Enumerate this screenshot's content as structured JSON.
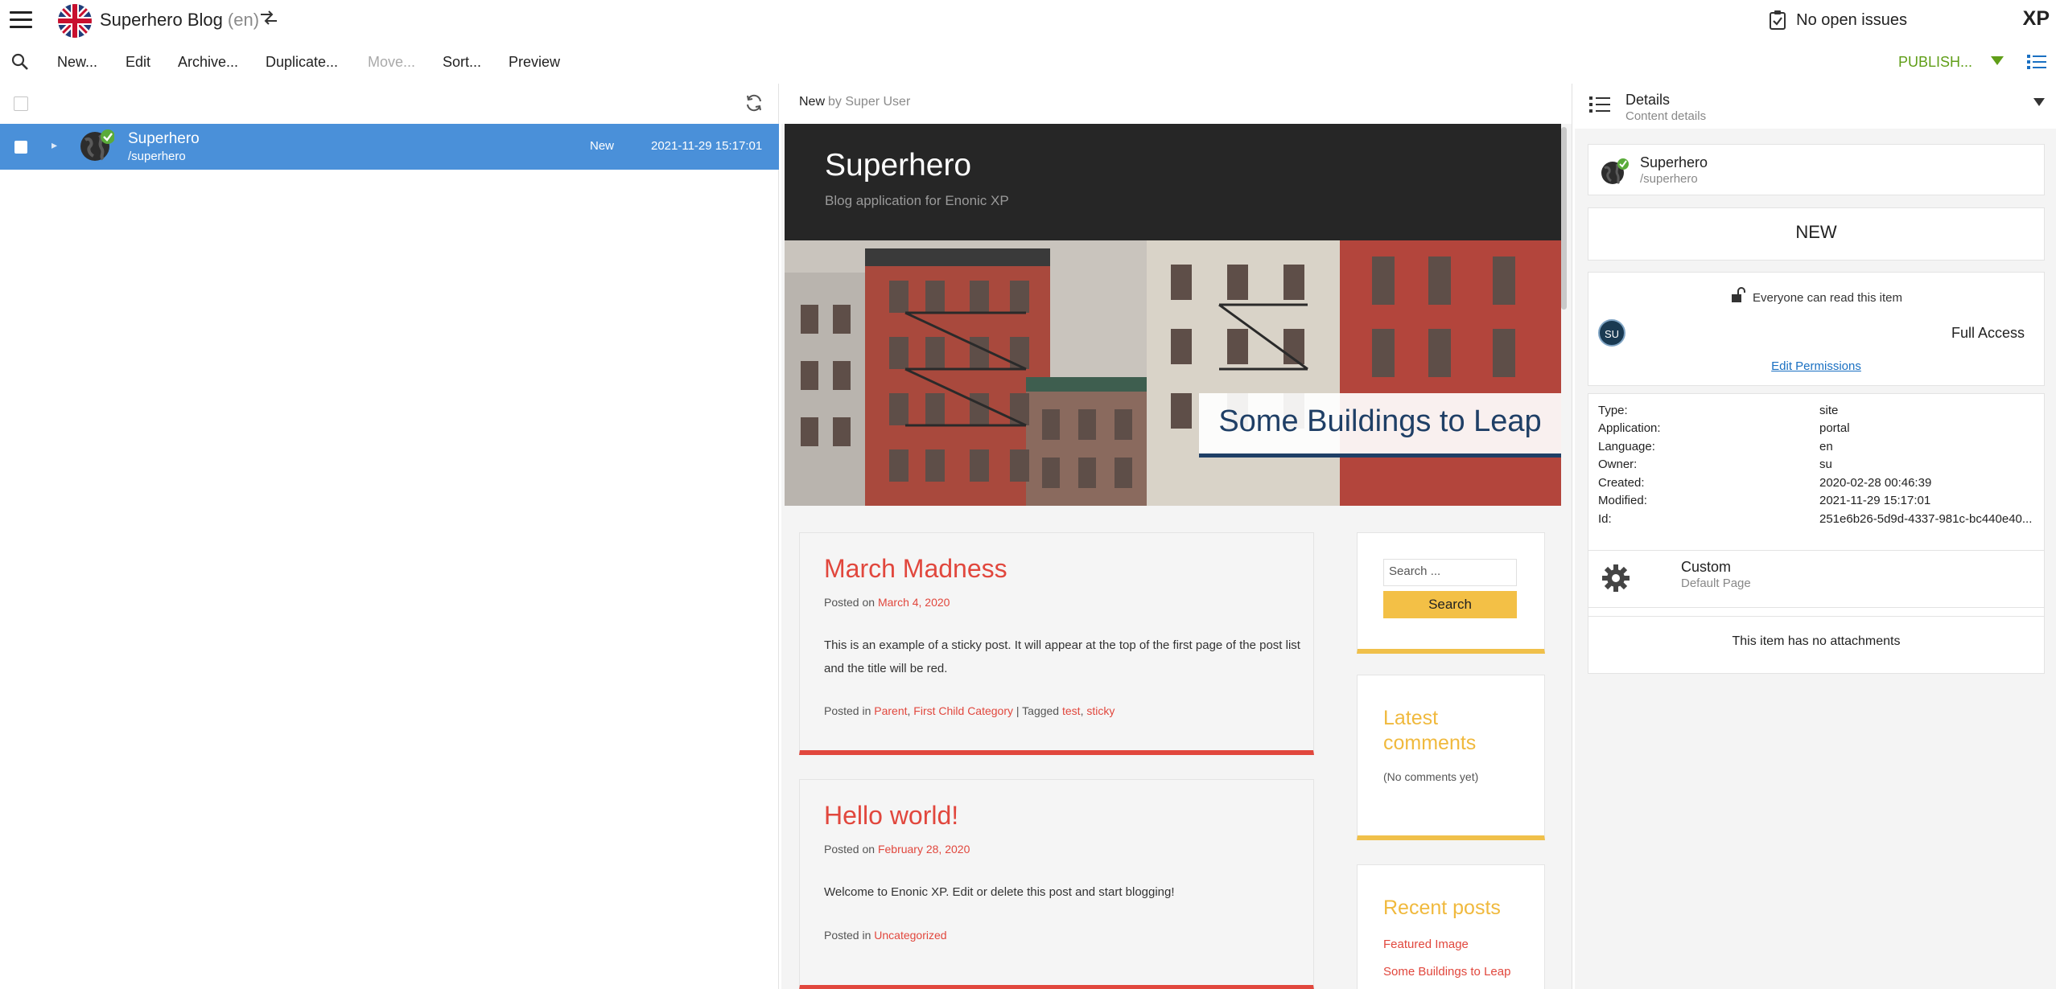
{
  "topbar": {
    "project_name": "Superhero Blog",
    "project_lang": "(en)",
    "issues": "No open issues",
    "logo": "XP"
  },
  "toolbar": {
    "new": "New...",
    "edit": "Edit",
    "archive": "Archive...",
    "duplicate": "Duplicate...",
    "move": "Move...",
    "sort": "Sort...",
    "preview": "Preview",
    "publish": "PUBLISH..."
  },
  "tree": {
    "items": [
      {
        "name": "Superhero",
        "path": "/superhero",
        "status": "New",
        "modified": "2021-11-29 15:17:01"
      }
    ]
  },
  "preview": {
    "status": "New",
    "by": "by Super User",
    "site_title": "Superhero",
    "site_tagline": "Blog application for Enonic XP",
    "hero_caption": "Some Buildings to Leap",
    "posts": [
      {
        "title": "March Madness",
        "posted_on": "Posted on",
        "date": "March 4, 2020",
        "body": "This is an example of a sticky post. It will appear at the top of the first page of the post list and the title will be red.",
        "posted_in": "Posted in",
        "categories": [
          "Parent",
          "First Child Category"
        ],
        "tagged_label": "| Tagged",
        "tags": [
          "test",
          "sticky"
        ]
      },
      {
        "title": "Hello world!",
        "posted_on": "Posted on",
        "date": "February 28, 2020",
        "body": "Welcome to Enonic XP. Edit or delete this post and start blogging!",
        "posted_in": "Posted in",
        "categories": [
          "Uncategorized"
        ]
      }
    ],
    "search_placeholder": "Search ...",
    "search_button": "Search",
    "latest_comments_title": "Latest comments",
    "latest_comments_empty": "(No comments yet)",
    "recent_posts_title": "Recent posts",
    "recent_posts": [
      "Featured Image",
      "Some Buildings to Leap"
    ]
  },
  "details": {
    "title": "Details",
    "subtitle": "Content details",
    "name": "Superhero",
    "path": "/superhero",
    "status": "NEW",
    "permission_summary": "Everyone can read this item",
    "avatar": "SU",
    "access_level": "Full Access",
    "edit_permissions": "Edit Permissions",
    "properties": [
      {
        "key": "Type:",
        "value": "site"
      },
      {
        "key": "Application:",
        "value": "portal"
      },
      {
        "key": "Language:",
        "value": "en"
      },
      {
        "key": "Owner:",
        "value": "su"
      },
      {
        "key": "Created:",
        "value": "2020-02-28 00:46:39"
      },
      {
        "key": "Modified:",
        "value": "2021-11-29 15:17:01"
      },
      {
        "key": "Id:",
        "value": "251e6b26-5d9d-4337-981c-bc440e40..."
      }
    ],
    "page_template": "Custom",
    "page_template_sub": "Default Page",
    "attachments": "This item has no attachments"
  },
  "colors": {
    "selection": "#4a90d9",
    "publish": "#609e18",
    "post_accent": "#e1473d",
    "widget_accent": "#f0b93d"
  }
}
